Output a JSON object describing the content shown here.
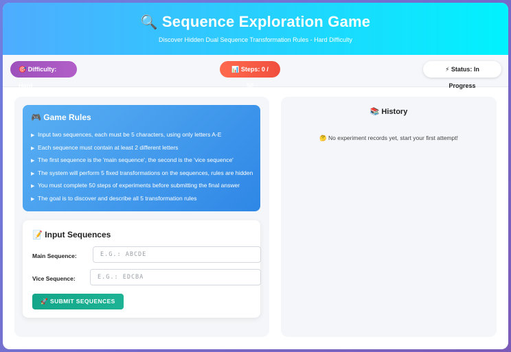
{
  "header": {
    "icon": "magnifier-icon",
    "title": "Sequence Exploration Game",
    "subtitle": "Discover Hidden Dual Sequence Transformation Rules - Hard Difficulty"
  },
  "status": {
    "difficulty": "Difficulty: Hard",
    "steps": "Steps: 0 / 50",
    "state": "Status: In Progress"
  },
  "rules": {
    "title": "Game Rules",
    "items": [
      "Input two sequences, each must be 5 characters, using only letters A-E",
      "Each sequence must contain at least 2 different letters",
      "The first sequence is the 'main sequence', the second is the 'vice sequence'",
      "The system will perform 5 fixed transformations on the sequences, rules are hidden",
      "You must complete 50 steps of experiments before submitting the final answer",
      "The goal is to discover and describe all 5 transformation rules"
    ]
  },
  "input": {
    "title": "Input Sequences",
    "main_label": "Main Sequence:",
    "main_placeholder": "E.G.: ABCDE",
    "main_value": "",
    "vice_label": "Vice Sequence:",
    "vice_placeholder": "E.G.: EDCBA",
    "vice_value": "",
    "submit_label": "SUBMIT SEQUENCES"
  },
  "history": {
    "title": "History",
    "empty_text": "No experiment records yet, start your first attempt!"
  },
  "colors": {
    "header_start": "#4facfe",
    "header_end": "#00f2fe",
    "difficulty_pill": "#9d50bb",
    "steps_pill": "#f04e3e",
    "rules_bg": "#2f87e6",
    "submit_bg": "#1db394"
  }
}
